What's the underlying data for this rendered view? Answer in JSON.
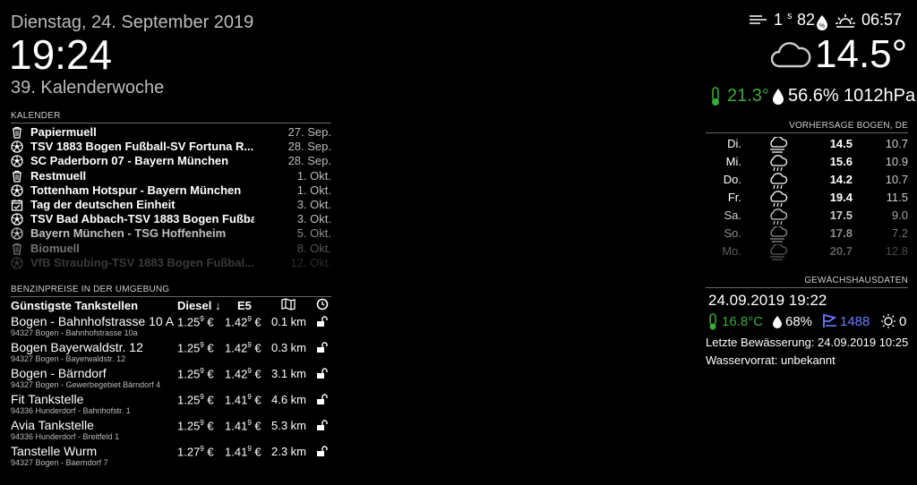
{
  "clock": {
    "date": "Dienstag, 24. September 2019",
    "time": "19:24",
    "week": "39. Kalenderwoche"
  },
  "calendar": {
    "header": "KALENDER",
    "events": [
      {
        "title": "Papiermuell",
        "date": "27. Sep.",
        "icon": "trash-icon"
      },
      {
        "title": "TSV 1883 Bogen Fußball-SV Fortuna R...",
        "date": "28. Sep.",
        "icon": "soccer-ball-icon"
      },
      {
        "title": "SC Paderborn 07 - Bayern München",
        "date": "28. Sep.",
        "icon": "soccer-ball-icon"
      },
      {
        "title": "Restmuell",
        "date": "1. Okt.",
        "icon": "trash-icon"
      },
      {
        "title": "Tottenham Hotspur - Bayern München",
        "date": "1. Okt.",
        "icon": "soccer-ball-icon"
      },
      {
        "title": "Tag der deutschen Einheit",
        "date": "3. Okt.",
        "icon": "calendar-check-icon"
      },
      {
        "title": "TSV Bad Abbach-TSV 1883 Bogen Fußba...",
        "date": "3. Okt.",
        "icon": "soccer-ball-icon"
      },
      {
        "title": "Bayern München - TSG Hoffenheim",
        "date": "5. Okt.",
        "icon": "soccer-ball-icon"
      },
      {
        "title": "Biomuell",
        "date": "8. Okt.",
        "icon": "trash-icon"
      },
      {
        "title": "VfB Straubing-TSV 1883 Bogen Fußbal...",
        "date": "12. Okt.",
        "icon": "soccer-ball-icon"
      }
    ]
  },
  "fuel": {
    "header": "BENZINPREISE IN DER UMGEBUNG",
    "col_name": "Günstigste Tankstellen",
    "col_diesel": "Diesel",
    "col_e5": "E5",
    "stations": [
      {
        "name": "Bogen - Bahnhofstrasse 10 A",
        "addr": "94327 Bogen - Bahnhofstrasse 10a",
        "diesel": "1.25",
        "diesel_sup": "9",
        "e5": "1.42",
        "e5_sup": "9",
        "dist": "0.1 km"
      },
      {
        "name": "Bogen Bayerwaldstr. 12",
        "addr": "94327 Bogen - Bayerwaldstr. 12",
        "diesel": "1.25",
        "diesel_sup": "9",
        "e5": "1.42",
        "e5_sup": "9",
        "dist": "0.3 km"
      },
      {
        "name": "Bogen - Bärndorf",
        "addr": "94327 Bogen - Gewerbegebiet Bärndorf 4",
        "diesel": "1.25",
        "diesel_sup": "9",
        "e5": "1.42",
        "e5_sup": "9",
        "dist": "3.1 km"
      },
      {
        "name": "Fit Tankstelle",
        "addr": "94336 Hunderdorf - Bahnhofstr. 1",
        "diesel": "1.25",
        "diesel_sup": "9",
        "e5": "1.41",
        "e5_sup": "9",
        "dist": "4.6 km"
      },
      {
        "name": "Avia Tankstelle",
        "addr": "94336 Hunderdorf - Breitfeld 1",
        "diesel": "1.25",
        "diesel_sup": "9",
        "e5": "1.41",
        "e5_sup": "9",
        "dist": "5.3 km"
      },
      {
        "name": "Tanstelle Wurm",
        "addr": "94327 Bogen - Baerndorf 7",
        "diesel": "1.27",
        "diesel_sup": "9",
        "e5": "1.41",
        "e5_sup": "9",
        "dist": "2.3 km"
      }
    ],
    "euro": "€"
  },
  "weather": {
    "wind": "1",
    "wind_unit": "s",
    "humidity": "82",
    "sunset": "06:57",
    "temp": "14.5°",
    "indoor_temp": "21.3°",
    "indoor_humidity": "56.6%",
    "pressure": "1012hPa",
    "accent_green": "#3aaa3a"
  },
  "forecast": {
    "header": "VORHERSAGE BOGEN, DE",
    "days": [
      {
        "day": "Di.",
        "hi": "14.5",
        "lo": "10.7",
        "icon": "cloud-wind-icon"
      },
      {
        "day": "Mi.",
        "hi": "15.6",
        "lo": "10.9",
        "icon": "cloud-rain-icon"
      },
      {
        "day": "Do.",
        "hi": "14.2",
        "lo": "10.7",
        "icon": "cloud-rain-icon"
      },
      {
        "day": "Fr.",
        "hi": "19.4",
        "lo": "11.5",
        "icon": "cloud-rain-icon"
      },
      {
        "day": "Sa.",
        "hi": "17.5",
        "lo": "9.0",
        "icon": "cloud-rain-icon"
      },
      {
        "day": "So.",
        "hi": "17.8",
        "lo": "7.2",
        "icon": "cloud-wind-icon"
      },
      {
        "day": "Mo.",
        "hi": "20.7",
        "lo": "12.8",
        "icon": "cloud-wind-icon"
      }
    ]
  },
  "greenhouse": {
    "header": "GEWÄCHSHAUSDATEN",
    "datetime": "24.09.2019 19:22",
    "temp": "16.8°C",
    "humidity": "68%",
    "moisture": "1488",
    "light": "0",
    "last_watering": "Letzte Bewässerung: 24.09.2019 10:25",
    "water_supply": "Wasservorrat: unbekannt",
    "accent_blue": "#6b7bff"
  }
}
